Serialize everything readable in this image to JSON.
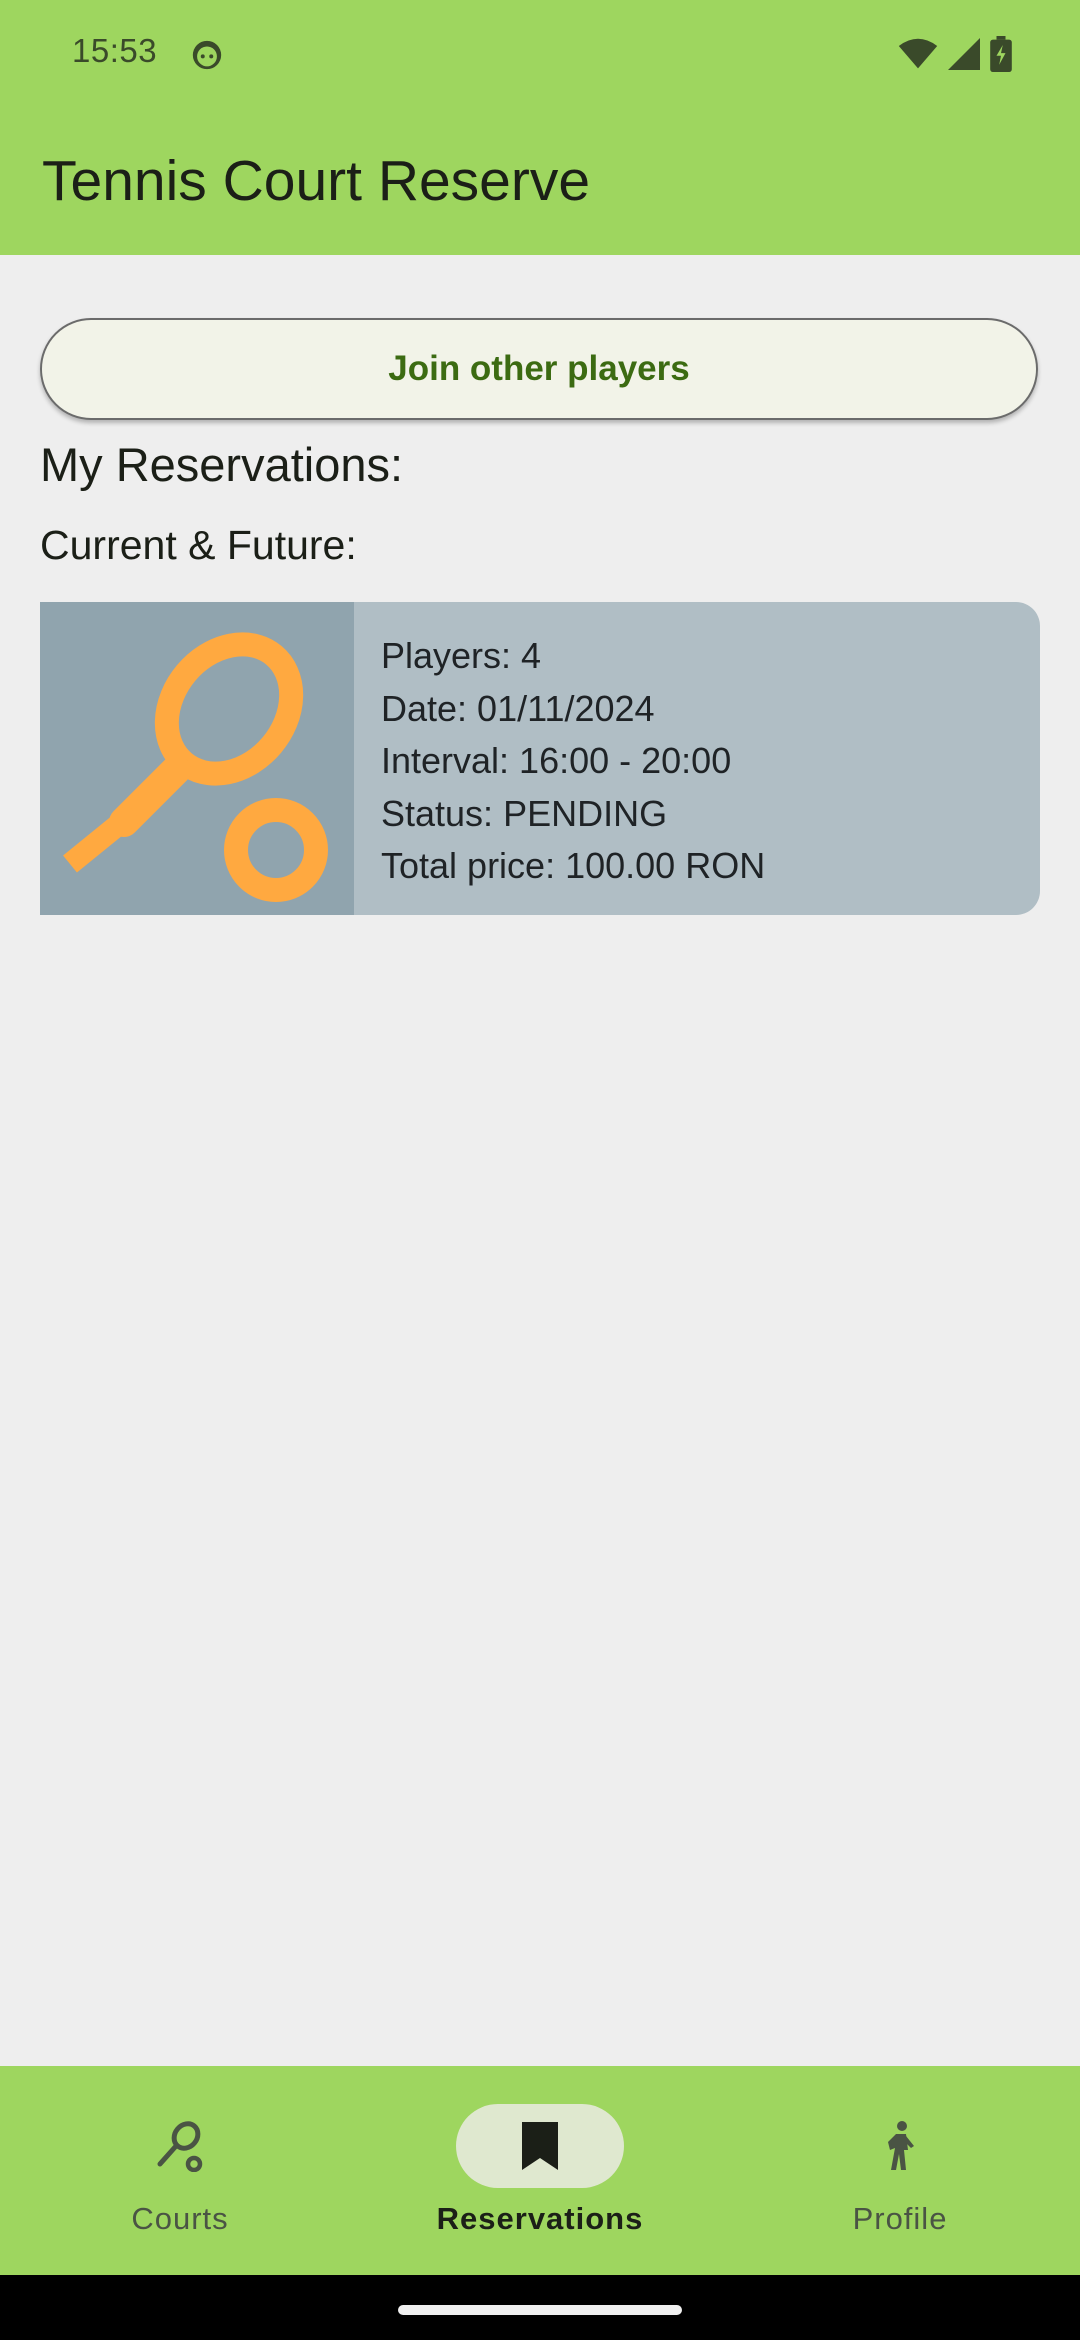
{
  "status_bar": {
    "time": "15:53"
  },
  "app_bar": {
    "title": "Tennis Court Reserve"
  },
  "actions": {
    "join_label": "Join other players"
  },
  "reservations": {
    "section_title": "My Reservations:",
    "current_title": "Current & Future:",
    "items": [
      {
        "players": "Players: 4",
        "date": "Date: 01/11/2024",
        "interval": "Interval: 16:00 - 20:00",
        "status": "Status: PENDING",
        "price": "Total price: 100.00 RON",
        "icon": "tennis-racket-ball-icon"
      }
    ]
  },
  "bottom_nav": {
    "items": [
      {
        "label": "Courts",
        "icon": "tennis-racket-icon",
        "active": false
      },
      {
        "label": "Reservations",
        "icon": "bookmark-icon",
        "active": true
      },
      {
        "label": "Profile",
        "icon": "walking-person-icon",
        "active": false
      }
    ]
  },
  "colors": {
    "app_bar": "#9ed65f",
    "background": "#eeeeee",
    "card": "#b0bec5",
    "card_image": "#90a4ae",
    "accent_icon": "#ffa940",
    "button_text": "#3c6b12"
  }
}
